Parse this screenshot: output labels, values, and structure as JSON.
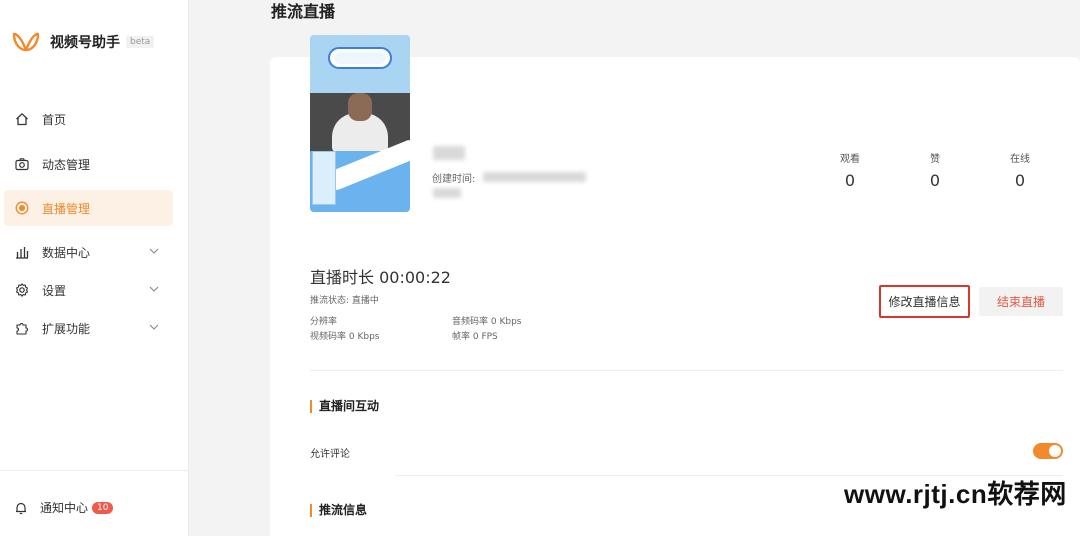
{
  "app": {
    "name": "视频号助手",
    "badge": "beta",
    "brand_color": "#f08a2d"
  },
  "sidebar": {
    "items": [
      {
        "label": "首页",
        "icon": "home-icon"
      },
      {
        "label": "动态管理",
        "icon": "camera-icon"
      },
      {
        "label": "直播管理",
        "icon": "live-icon",
        "active": true
      },
      {
        "label": "数据中心",
        "icon": "bar-chart-icon",
        "expandable": true
      },
      {
        "label": "设置",
        "icon": "gear-icon",
        "expandable": true
      },
      {
        "label": "扩展功能",
        "icon": "puzzle-icon",
        "expandable": true
      }
    ],
    "notify": {
      "label": "通知中心",
      "count": "10",
      "icon": "bell-icon"
    }
  },
  "page": {
    "title": "推流直播"
  },
  "stream": {
    "created_label": "创建时间:",
    "stats": [
      {
        "label": "观看",
        "value": "0"
      },
      {
        "label": "赞",
        "value": "0"
      },
      {
        "label": "在线",
        "value": "0"
      }
    ],
    "duration": "直播时长 00:00:22",
    "status": "推流状态:  直播中",
    "resolution_label": "分辨率",
    "video_bitrate": "视频码率 0 Kbps",
    "audio_bitrate": "音频码率 0 Kbps",
    "frame_rate": "帧率 0 FPS",
    "edit_button": "修改直播信息",
    "end_button": "结束直播"
  },
  "interaction": {
    "title": "直播间互动",
    "allow_comment_label": "允许评论",
    "allow_comment": true
  },
  "push_info": {
    "title": "推流信息"
  },
  "watermark": "www.rjtj.cn软荐网"
}
